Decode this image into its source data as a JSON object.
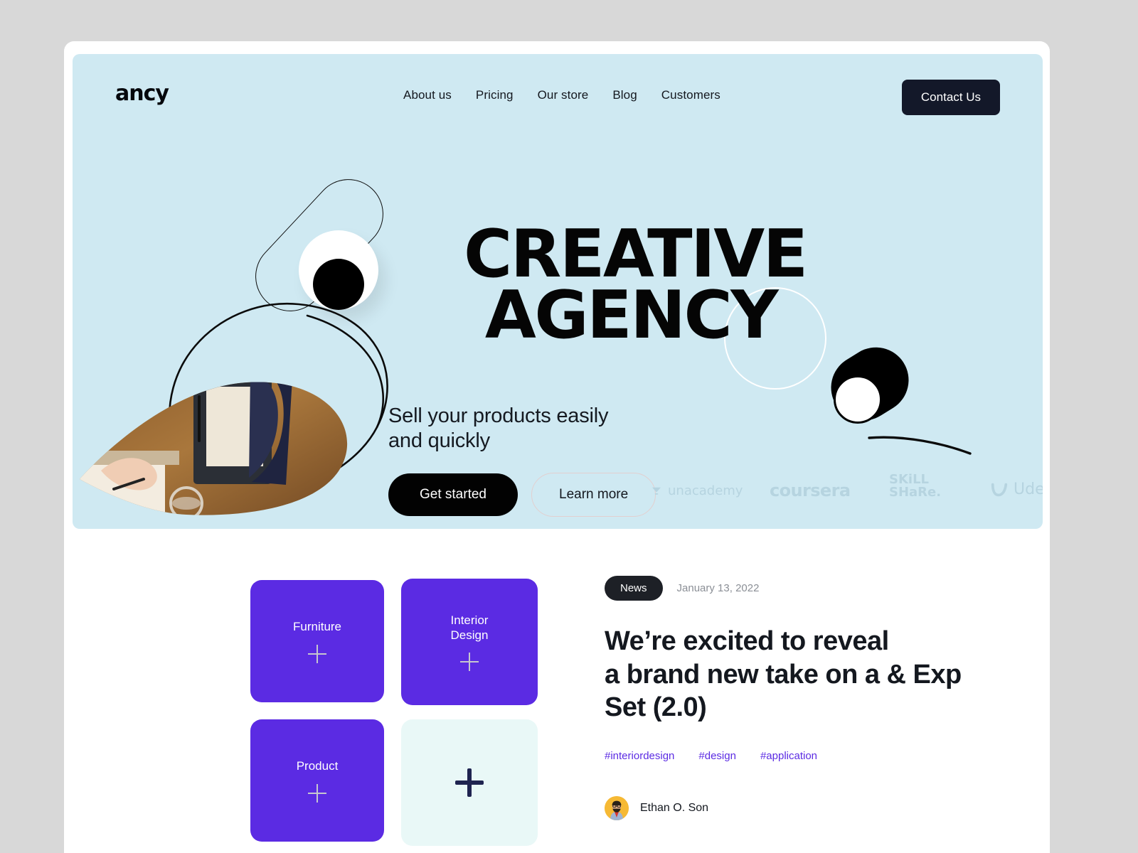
{
  "brand": {
    "logo_text": "ancy"
  },
  "nav": {
    "items": [
      {
        "label": "About us"
      },
      {
        "label": "Pricing"
      },
      {
        "label": "Our store"
      },
      {
        "label": "Blog"
      },
      {
        "label": "Customers"
      }
    ],
    "cta_label": "Contact Us"
  },
  "hero": {
    "title": "CREATIVE\nAGENCY",
    "subtitle": "Sell your products easily\nand quickly",
    "primary_button": "Get started",
    "secondary_button": "Learn more",
    "partners": [
      {
        "name": "unacademy",
        "icon": "unacademy-logo-icon"
      },
      {
        "name": "coursera",
        "icon": "coursera-logo-icon"
      },
      {
        "name": "SKiLL\nSHaRe.",
        "icon": "skillshare-logo-icon"
      },
      {
        "name": "Udemy",
        "icon": "udemy-logo-icon"
      }
    ],
    "decor": {
      "toggle_pill": "rotated-pill-outline",
      "black_pill": "rotated-black-pill",
      "white_ring": "thin-white-circle",
      "spiral": "black-spiral-line",
      "arc": "thin-black-arc",
      "photo": "desk-hand-writing-photo"
    }
  },
  "colors": {
    "hero_bg": "#cfe9f2",
    "purple": "#5b2be3",
    "dark": "#131829",
    "mint": "#e9f8f7",
    "muted_logo": "#b6d4e0",
    "date_gray": "#8b8f96"
  },
  "cards": [
    {
      "label": "Furniture",
      "style": "purple",
      "plus": "plus-icon"
    },
    {
      "label": "Interior\nDesign",
      "style": "purple",
      "plus": "plus-icon"
    },
    {
      "label": "Product",
      "style": "purple",
      "plus": "plus-icon"
    },
    {
      "label": "",
      "style": "mint",
      "plus": "plus-icon"
    }
  ],
  "article": {
    "badge": "News",
    "date": "January 13, 2022",
    "title": "We’re excited to reveal\na brand new take on a & Exp\nSet (2.0)",
    "tags": [
      "#interiordesign",
      "#design",
      "#application"
    ],
    "author": {
      "name": "Ethan O. Son",
      "avatar": "author-avatar"
    }
  }
}
